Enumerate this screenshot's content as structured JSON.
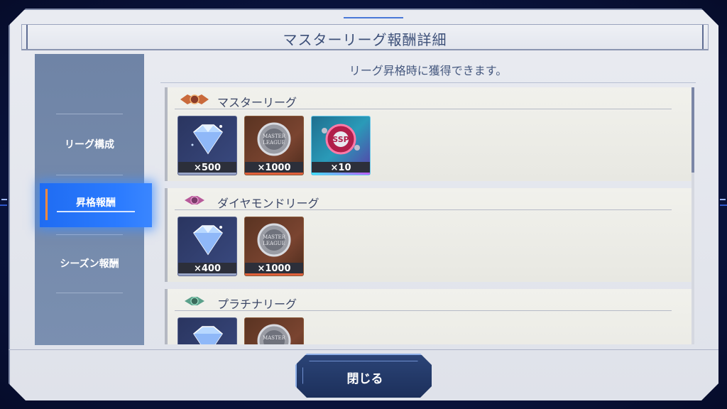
{
  "dialog": {
    "title": "マスターリーグ報酬詳細",
    "subtitle": "リーグ昇格時に獲得できます。",
    "close_label": "閉じる"
  },
  "sidebar": {
    "items": [
      {
        "label": "リーグ構成",
        "active": false
      },
      {
        "label": "昇格報酬",
        "active": true
      },
      {
        "label": "シーズン報酬",
        "active": false
      }
    ]
  },
  "leagues": [
    {
      "name": "マスターリーグ",
      "emblem": "master-league-emblem-icon",
      "rewards": [
        {
          "icon": "diamond-icon",
          "qty": "×500",
          "kind": "diamond"
        },
        {
          "icon": "master-league-medal-icon",
          "qty": "×1000",
          "kind": "medal"
        },
        {
          "icon": "ssp-ticket-icon",
          "qty": "×10",
          "kind": "ssp"
        }
      ]
    },
    {
      "name": "ダイヤモンドリーグ",
      "emblem": "diamond-league-emblem-icon",
      "rewards": [
        {
          "icon": "diamond-icon",
          "qty": "×400",
          "kind": "diamond"
        },
        {
          "icon": "master-league-medal-icon",
          "qty": "×1000",
          "kind": "medal"
        }
      ]
    },
    {
      "name": "プラチナリーグ",
      "emblem": "platinum-league-emblem-icon",
      "rewards": [
        {
          "icon": "diamond-icon",
          "qty": "",
          "kind": "diamond"
        },
        {
          "icon": "master-league-medal-icon",
          "qty": "",
          "kind": "medal"
        }
      ]
    }
  ],
  "colors": {
    "accent_blue": "#2b7bff",
    "panel_bg": "#e9ebf1",
    "sidebar_bg": "#7489aa"
  }
}
